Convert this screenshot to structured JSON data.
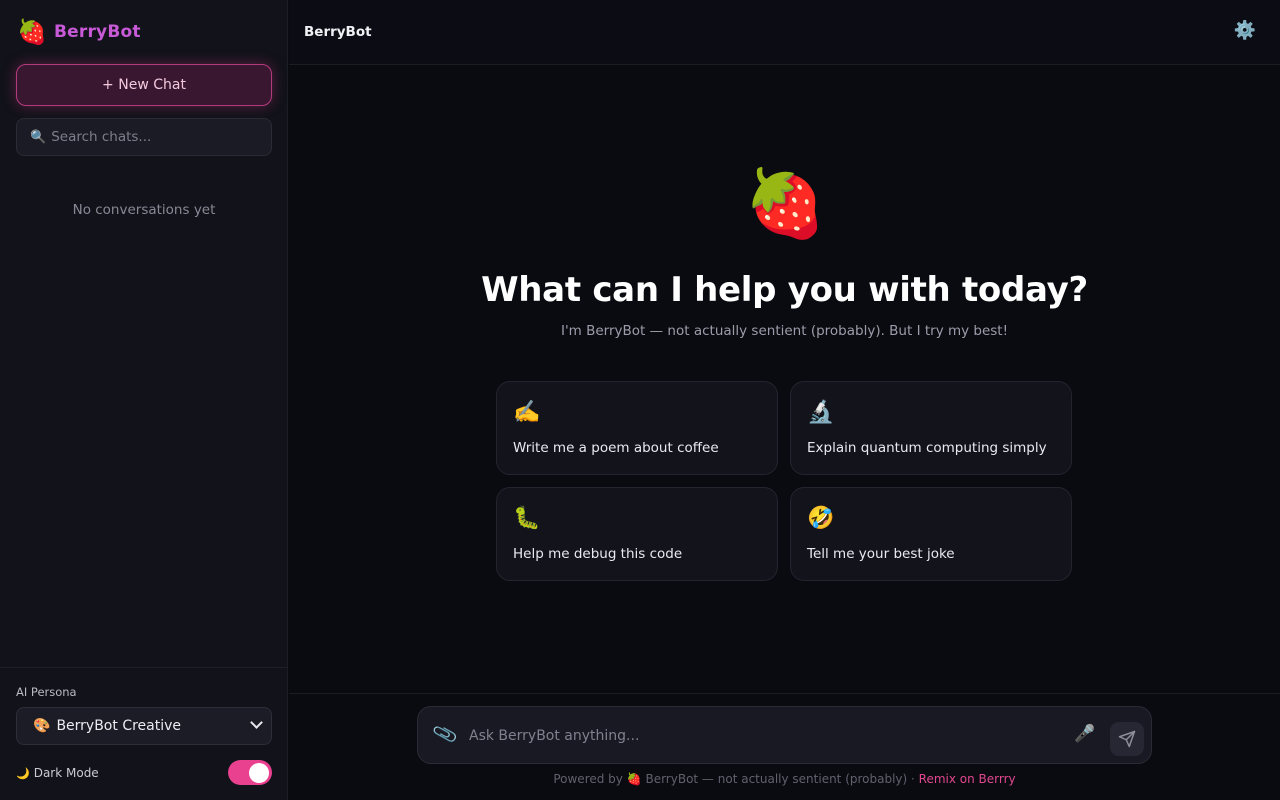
{
  "sidebar": {
    "brand": {
      "logo": "🍓",
      "name": "BerryBot"
    },
    "new_chat_label": "+ New Chat",
    "search": {
      "icon": "🔍",
      "placeholder": "Search chats..."
    },
    "empty_text": "No conversations yet",
    "persona": {
      "label": "AI Persona",
      "selected_emoji": "🎨",
      "selected": "BerryBot Creative"
    },
    "dark_mode": {
      "emoji": "🌙",
      "label": "Dark Mode",
      "enabled": true
    }
  },
  "header": {
    "title": "BerryBot",
    "settings_icon": "⚙️"
  },
  "main": {
    "hero_emoji": "🍓",
    "headline": "What can I help you with today?",
    "subline": "I'm BerryBot — not actually sentient (probably). But I try my best!",
    "suggestions": [
      {
        "icon": "✍️",
        "label": "Write me a poem about coffee"
      },
      {
        "icon": "🔬",
        "label": "Explain quantum computing simply"
      },
      {
        "icon": "🐛",
        "label": "Help me debug this code"
      },
      {
        "icon": "🤣",
        "label": "Tell me your best joke"
      }
    ]
  },
  "composer": {
    "attach_icon": "📎",
    "placeholder": "Ask BerryBot anything...",
    "mic_icon": "🎤"
  },
  "footer": {
    "text": "Powered by 🍓 BerryBot — not actually sentient (probably) · ",
    "link": "Remix on Berrry"
  },
  "colors": {
    "accent": "#e9418f",
    "brand": "#c85ad8",
    "background": "#0a0b11",
    "sidebar": "#11121a"
  }
}
